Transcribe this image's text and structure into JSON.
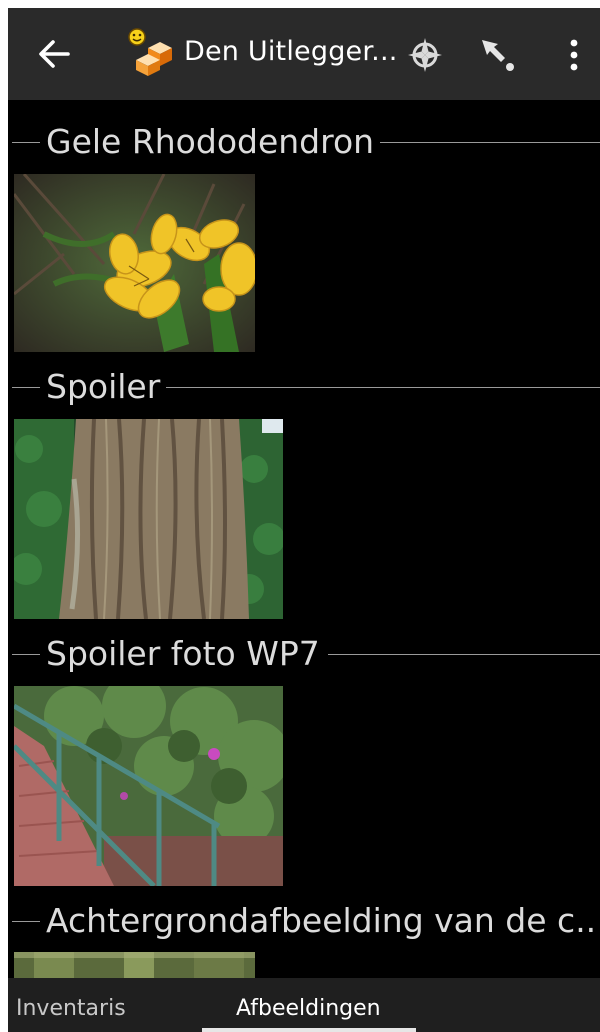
{
  "actionbar": {
    "title": "Den Uitlegger...",
    "icons": {
      "back": "arrow-left-icon",
      "cache": "cache-type-icon",
      "compass": "compass-icon",
      "navigate": "navigate-icon",
      "menu": "overflow-menu-icon"
    }
  },
  "sections": [
    {
      "title": "Gele Rhododendron"
    },
    {
      "title": "Spoiler"
    },
    {
      "title": "Spoiler foto WP7"
    },
    {
      "title": "Achtergrondafbeelding van de c.."
    }
  ],
  "tabs": [
    {
      "label": "Inventaris",
      "active": false
    },
    {
      "label": "Afbeeldingen",
      "active": true
    }
  ],
  "colors": {
    "background": "#000000",
    "actionbar": "#2a2a2a",
    "text": "#dcdcdc",
    "tabbar": "#1f1f1f"
  }
}
